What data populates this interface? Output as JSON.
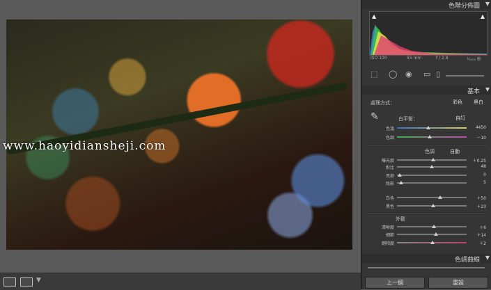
{
  "watermark": "www.haoyidiansheji.com",
  "panel": {
    "histogram_title": "色階分佈圖",
    "histogram_info": {
      "iso": "ISO 100",
      "focal": "55 mm",
      "aperture": "f / 2.8",
      "shutter": "¹⁄₁₀₀₀ 秒"
    },
    "basic_title": "基本",
    "treatment_label": "處理方式：",
    "treatment_color": "彩色",
    "treatment_bw": "黑白",
    "wb_label": "白平衡：",
    "wb_value": "自訂",
    "tone_title": "色調",
    "tone_auto": "自動",
    "presence_title": "外觀",
    "tone_curve_title": "色調曲線",
    "prev_button": "上一個",
    "reset_button": "重設",
    "sliders": [
      {
        "label": "色溫",
        "value": "4450",
        "pos": 0.45
      },
      {
        "label": "色調",
        "value": "－10",
        "pos": 0.47
      },
      {
        "label": "曝光度",
        "value": "＋0.25",
        "pos": 0.52
      },
      {
        "label": "對比",
        "value": "48",
        "pos": 0.5
      },
      {
        "label": "亮部",
        "value": "0",
        "pos": 0.04
      },
      {
        "label": "陰影",
        "value": "5",
        "pos": 0.06
      },
      {
        "label": "白色",
        "value": "＋50",
        "pos": 0.62
      },
      {
        "label": "黑色",
        "value": "＋23",
        "pos": 0.52
      },
      {
        "label": "清晰度",
        "value": "＋6",
        "pos": 0.53
      },
      {
        "label": "細節",
        "value": "＋14",
        "pos": 0.56
      },
      {
        "label": "飽和度",
        "value": "＋2",
        "pos": 0.51
      }
    ]
  },
  "colors": {
    "panel_bg": "#353535",
    "canvas_bg": "#5a5a5a"
  }
}
